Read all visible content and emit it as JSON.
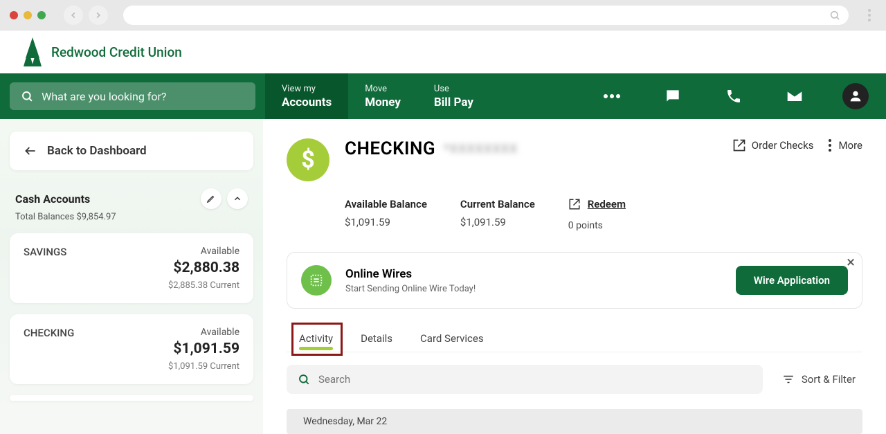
{
  "brand": {
    "name": "Redwood Credit Union",
    "color": "#0f6b3a",
    "accent": "#a5cd39"
  },
  "search": {
    "placeholder": "What are you looking for?"
  },
  "nav": {
    "items": [
      {
        "top": "View my",
        "bot": "Accounts"
      },
      {
        "top": "Move",
        "bot": "Money"
      },
      {
        "top": "Use",
        "bot": "Bill Pay"
      }
    ]
  },
  "sidebar": {
    "back": "Back to Dashboard",
    "cash_title": "Cash Accounts",
    "cash_balances_label": "Total Balances $9,854.97",
    "accounts": [
      {
        "name": "SAVINGS",
        "avail_label": "Available",
        "amount": "$2,880.38",
        "current": "$2,885.38 Current"
      },
      {
        "name": "CHECKING",
        "avail_label": "Available",
        "amount": "$1,091.59",
        "current": "$1,091.59 Current"
      }
    ]
  },
  "account": {
    "title": "CHECKING",
    "masked": "*XXXXXXXX",
    "avail_label": "Available Balance",
    "avail_value": "$1,091.59",
    "cur_label": "Current Balance",
    "cur_value": "$1,091.59",
    "redeem_label": "Redeem",
    "points": "0 points",
    "order_checks": "Order Checks",
    "more": "More"
  },
  "promo": {
    "title": "Online Wires",
    "sub": "Start Sending Online Wire Today!",
    "cta": "Wire Application"
  },
  "tabs": [
    "Activity",
    "Details",
    "Card Services"
  ],
  "list": {
    "search_placeholder": "Search",
    "sort_filter": "Sort & Filter",
    "date_header": "Wednesday, Mar 22"
  }
}
